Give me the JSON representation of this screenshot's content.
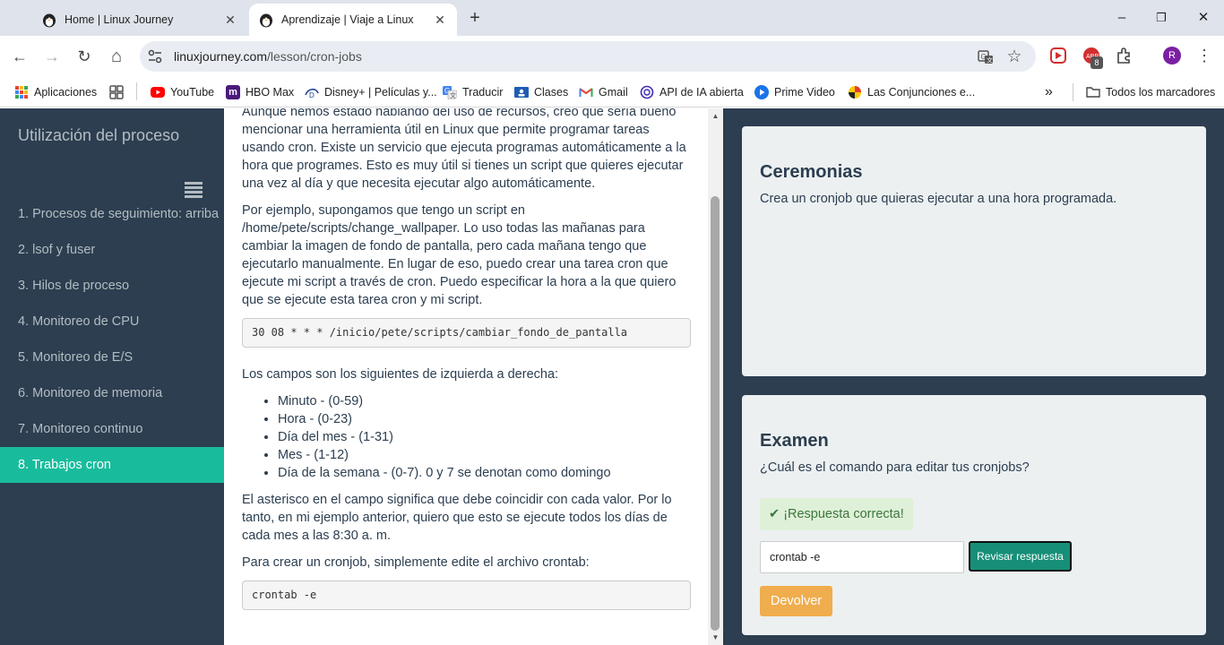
{
  "browser": {
    "tabs": [
      {
        "title": "Home | Linux Journey",
        "active": false
      },
      {
        "title": "Aprendizaje | Viaje a Linux",
        "active": true
      }
    ],
    "new_tab": "+",
    "window_controls": {
      "minimize": "–",
      "restore": "❐",
      "close": "✕"
    },
    "nav": {
      "back": "←",
      "forward": "→",
      "reload": "↻",
      "home": "⌂"
    },
    "address": {
      "domain": "linuxjourney.com",
      "path": "/lesson/cron-jobs"
    },
    "profile_initial": "R",
    "extension_badge": "8",
    "bookmarks": [
      {
        "label": "Aplicaciones",
        "icon": "apps-grid-icon"
      },
      {
        "label": "",
        "icon": "apps-launcher-icon"
      },
      {
        "label": "YouTube",
        "icon": "youtube-icon"
      },
      {
        "label": "HBO Max",
        "icon": "hbo-max-icon"
      },
      {
        "label": "Disney+ | Películas y...",
        "icon": "disney-plus-icon"
      },
      {
        "label": "Traducir",
        "icon": "translate-icon"
      },
      {
        "label": "Clases",
        "icon": "classroom-icon"
      },
      {
        "label": "Gmail",
        "icon": "gmail-icon"
      },
      {
        "label": "API de IA abierta",
        "icon": "openai-icon"
      },
      {
        "label": "Prime Video",
        "icon": "prime-video-icon"
      },
      {
        "label": "Las Conjunciones e...",
        "icon": "bookmark-site-icon"
      }
    ],
    "bookmarks_overflow": "»",
    "all_bookmarks": "Todos los marcadores"
  },
  "sidebar": {
    "title": "Utilización del proceso",
    "items": [
      {
        "label": "1. Procesos de seguimiento: arriba",
        "active": false
      },
      {
        "label": "2. lsof y fuser",
        "active": false
      },
      {
        "label": "3. Hilos de proceso",
        "active": false
      },
      {
        "label": "4. Monitoreo de CPU",
        "active": false
      },
      {
        "label": "5. Monitoreo de E/S",
        "active": false
      },
      {
        "label": "6. Monitoreo de memoria",
        "active": false
      },
      {
        "label": "7. Monitoreo continuo",
        "active": false
      },
      {
        "label": "8. Trabajos cron",
        "active": true
      }
    ]
  },
  "lesson": {
    "p1": "Aunque hemos estado hablando del uso de recursos, creo que sería bueno mencionar una herramienta útil en Linux que permite programar tareas usando cron. Existe un servicio que ejecuta programas automáticamente a la hora que programes. Esto es muy útil si tienes un script que quieres ejecutar una vez al día y que necesita ejecutar algo automáticamente.",
    "p2": "Por ejemplo, supongamos que tengo un script en /home/pete/scripts/change_wallpaper. Lo uso todas las mañanas para cambiar la imagen de fondo de pantalla, pero cada mañana tengo que ejecutarlo manualmente. En lugar de eso, puedo crear una tarea cron que ejecute mi script a través de cron. Puedo especificar la hora a la que quiero que se ejecute esta tarea cron y mi script.",
    "code1": "30 08 * * * /inicio/pete/scripts/cambiar_fondo_de_pantalla",
    "p3": "Los campos son los siguientes de izquierda a derecha:",
    "fields": [
      "Minuto - (0-59)",
      "Hora - (0-23)",
      "Día del mes - (1-31)",
      "Mes - (1-12)",
      "Día de la semana - (0-7). 0 y 7 se denotan como domingo"
    ],
    "p4": "El asterisco en el campo significa que debe coincidir con cada valor. Por lo tanto, en mi ejemplo anterior, quiero que esto se ejecute todos los días de cada mes a las 8:30 a. m.",
    "p5": "Para crear un cronjob, simplemente edite el archivo crontab:",
    "code2": "crontab -e"
  },
  "exercises": {
    "title": "Ceremonias",
    "text": "Crea un cronjob que quieras ejecutar a una hora programada."
  },
  "quiz": {
    "title": "Examen",
    "question": "¿Cuál es el comando para editar tus cronjobs?",
    "feedback": "¡Respuesta correcta!",
    "answer_value": "crontab -e",
    "check_label": "Revisar respuesta",
    "back_label": "Devolver"
  },
  "colors": {
    "sidebar_bg": "#2c3e50",
    "active_item": "#18bc9c",
    "warning": "#f0ad4e",
    "success_bg": "#dff0d8"
  }
}
